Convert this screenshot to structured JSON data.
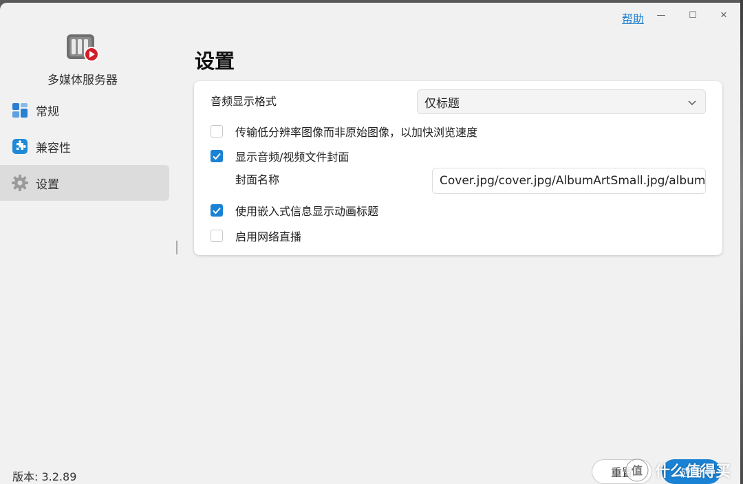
{
  "titlebar": {
    "help_label": "帮助",
    "minimize_glyph": "—",
    "maximize_glyph": "☐",
    "close_glyph": "✕"
  },
  "sidebar": {
    "app_name": "多媒体服务器",
    "app_icon": "media-server-icon",
    "items": [
      {
        "label": "常规",
        "icon": "general-icon",
        "active": false
      },
      {
        "label": "兼容性",
        "icon": "puzzle-icon",
        "active": false
      },
      {
        "label": "设置",
        "icon": "gear-icon",
        "active": true
      }
    ],
    "version": "版本: 3.2.89"
  },
  "main": {
    "title": "设置",
    "audio_format": {
      "label": "音频显示格式",
      "selected": "仅标题"
    },
    "options": [
      {
        "label": "传输低分辨率图像而非原始图像，以加快浏览速度",
        "checked": false
      },
      {
        "label": "显示音频/视频文件封面",
        "checked": true
      },
      {
        "label": "使用嵌入式信息显示动画标题",
        "checked": true
      },
      {
        "label": "启用网络直播",
        "checked": false
      }
    ],
    "cover_name": {
      "label": "封面名称",
      "value": "Cover.jpg/cover.jpg/AlbumArtSmall.jpg/albumartsma"
    }
  },
  "footer": {
    "reset_label": "重置",
    "apply_label": "应用"
  },
  "watermark": {
    "text": "什么值得买"
  },
  "colors": {
    "accent": "#1a82d4",
    "window_bg": "#f1f1f1",
    "active_nav_bg": "#dcdcdc",
    "help_link": "#1a7fd0"
  }
}
